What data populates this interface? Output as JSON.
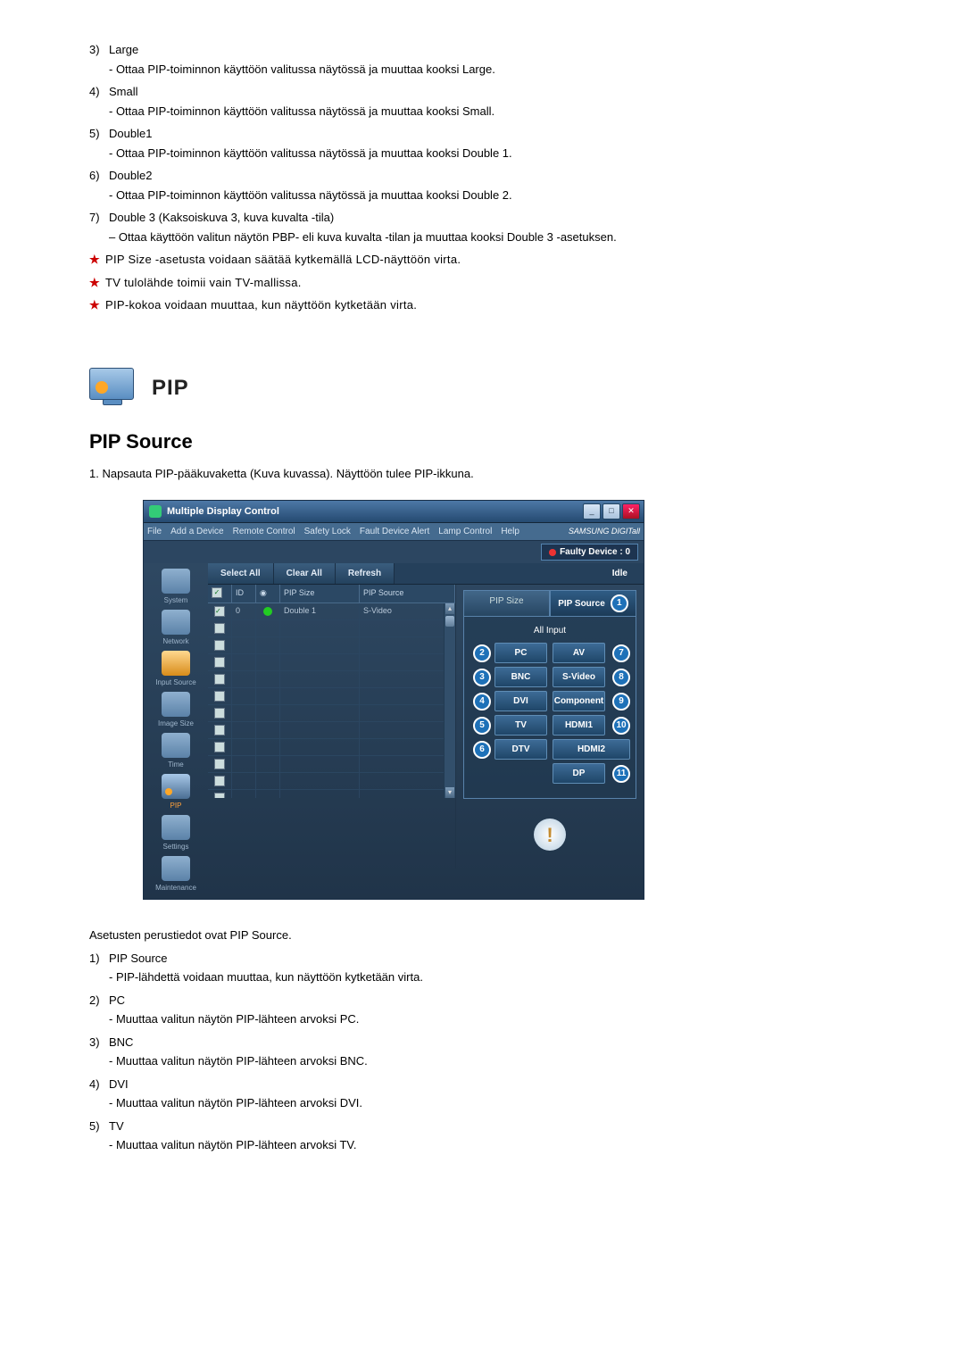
{
  "preList": [
    {
      "n": "3)",
      "title": "Large",
      "desc": "- Ottaa PIP-toiminnon käyttöön valitussa näytössä ja muuttaa kooksi Large."
    },
    {
      "n": "4)",
      "title": "Small",
      "desc": "- Ottaa PIP-toiminnon käyttöön valitussa näytössä ja muuttaa kooksi Small."
    },
    {
      "n": "5)",
      "title": "Double1",
      "desc": "- Ottaa PIP-toiminnon käyttöön valitussa näytössä ja muuttaa kooksi Double 1."
    },
    {
      "n": "6)",
      "title": "Double2",
      "desc": "- Ottaa PIP-toiminnon käyttöön valitussa näytössä ja muuttaa kooksi Double 2."
    },
    {
      "n": "7)",
      "title": "Double 3 (Kaksoiskuva 3, kuva kuvalta -tila)",
      "desc": "– Ottaa käyttöön valitun näytön PBP- eli kuva kuvalta -tilan ja muuttaa kooksi Double 3 -asetuksen."
    }
  ],
  "stars": [
    "PIP Size -asetusta voidaan säätää kytkemällä LCD-näyttöön virta.",
    "TV tulolähde toimii vain TV-mallissa.",
    "PIP-kokoa voidaan muuttaa, kun näyttöön kytketään virta."
  ],
  "sectionTitle": "PIP",
  "subTitle": "PIP Source",
  "intro": "1.  Napsauta PIP-pääkuvaketta (Kuva kuvassa). Näyttöön tulee PIP-ikkuna.",
  "app": {
    "title": "Multiple Display Control",
    "menu": [
      "File",
      "Add a Device",
      "Remote Control",
      "Safety Lock",
      "Fault Device Alert",
      "Lamp Control",
      "Help"
    ],
    "brand": "SAMSUNG DIGITall",
    "faulty": "Faulty Device : 0",
    "sidebar": [
      "System",
      "Network",
      "Input Source",
      "Image Size",
      "Time",
      "PIP",
      "Settings",
      "Maintenance"
    ],
    "toolbar": {
      "selectAll": "Select All",
      "clearAll": "Clear All",
      "refresh": "Refresh",
      "idle": "Idle"
    },
    "table": {
      "headers": {
        "id": "ID",
        "size": "PIP Size",
        "src": "PIP Source"
      },
      "row": {
        "id": "0",
        "size": "Double 1",
        "src": "S-Video"
      }
    },
    "panel": {
      "tabs": {
        "size": "PIP Size",
        "source": "PIP Source"
      },
      "circle1": "1",
      "allInput": "All Input",
      "left": [
        {
          "c": "2",
          "t": "PC"
        },
        {
          "c": "3",
          "t": "BNC"
        },
        {
          "c": "4",
          "t": "DVI"
        },
        {
          "c": "5",
          "t": "TV"
        },
        {
          "c": "6",
          "t": "DTV"
        }
      ],
      "right": [
        {
          "c": "7",
          "t": "AV"
        },
        {
          "c": "8",
          "t": "S-Video"
        },
        {
          "c": "9",
          "t": "Component"
        },
        {
          "c": "10",
          "t": "HDMI1"
        },
        {
          "c": "",
          "t": "HDMI2"
        },
        {
          "c": "11",
          "t": "DP"
        }
      ]
    }
  },
  "afterText": "Asetusten perustiedot ovat PIP Source.",
  "postList": [
    {
      "n": "1)",
      "title": "PIP Source",
      "desc": "- PIP-lähdettä voidaan muuttaa, kun näyttöön kytketään virta."
    },
    {
      "n": "2)",
      "title": "PC",
      "desc": "- Muuttaa valitun näytön PIP-lähteen arvoksi PC."
    },
    {
      "n": "3)",
      "title": "BNC",
      "desc": "- Muuttaa valitun näytön PIP-lähteen arvoksi BNC."
    },
    {
      "n": "4)",
      "title": "DVI",
      "desc": "- Muuttaa valitun näytön PIP-lähteen arvoksi DVI."
    },
    {
      "n": "5)",
      "title": "TV",
      "desc": "- Muuttaa valitun näytön PIP-lähteen arvoksi TV."
    }
  ]
}
